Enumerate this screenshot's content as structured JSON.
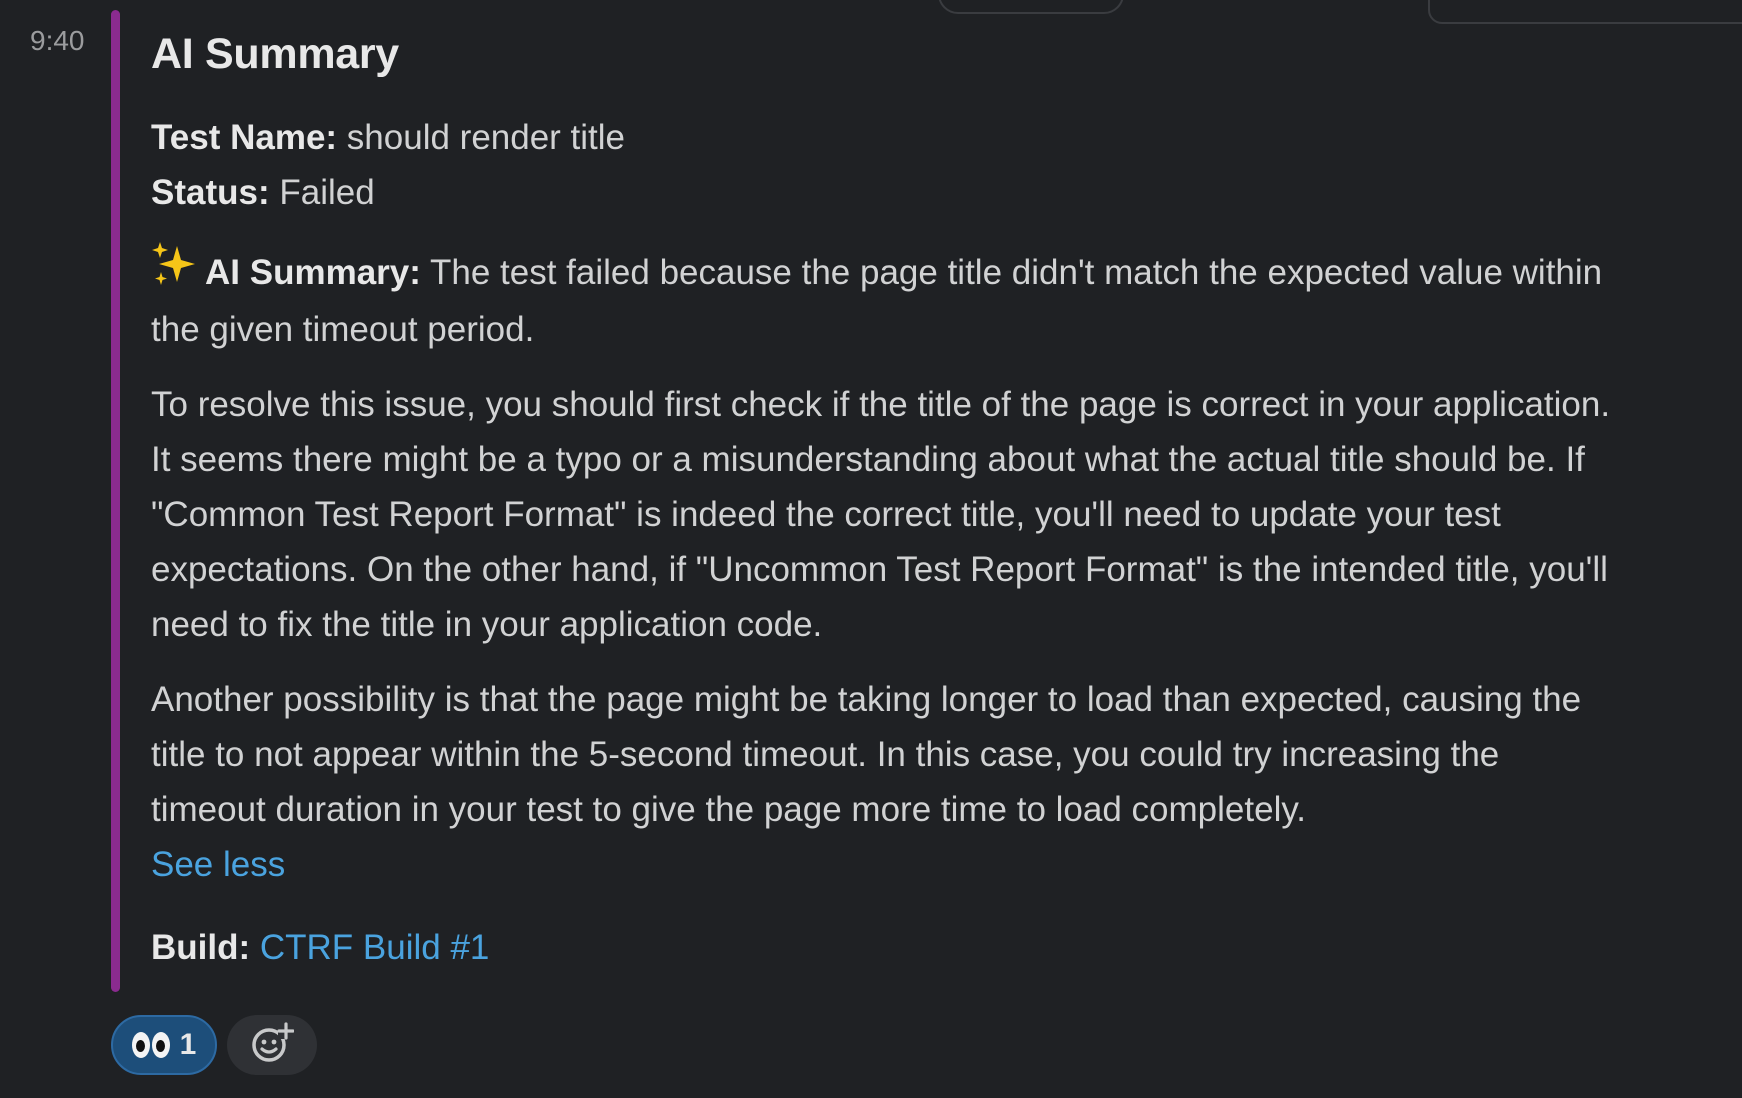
{
  "message": {
    "timestamp": "9:40",
    "accent_color": "#8a2b8f",
    "title": "AI Summary",
    "fields": {
      "test_name_label": "Test Name:",
      "test_name_value": " should render title",
      "status_label": "Status:",
      "status_value": " Failed"
    },
    "summary": {
      "icon": "sparkles-icon",
      "label": "AI Summary:",
      "text": " The test failed because the page title didn't match the expected value within the given timeout period."
    },
    "paragraphs": [
      "To resolve this issue, you should first check if the title of the page is correct in your application. It seems there might be a typo or a misunderstanding about what the actual title should be. If \"Common Test Report Format\" is indeed the correct title, you'll need to update your test expectations. On the other hand, if \"Uncommon Test Report Format\" is the intended title, you'll need to fix the title in your application code.",
      "Another possibility is that the page might be taking longer to load than expected, causing the title to not appear within the 5-second timeout. In this case, you could try increasing the timeout duration in your test to give the page more time to load completely."
    ],
    "see_less_label": "See less",
    "build": {
      "label": "Build:",
      "link_text": "CTRF Build #1",
      "link_color": "#4aa3df"
    }
  },
  "reactions": [
    {
      "emoji": "eyes-icon",
      "count": "1"
    }
  ],
  "add_reaction_icon": "add-reaction-icon"
}
